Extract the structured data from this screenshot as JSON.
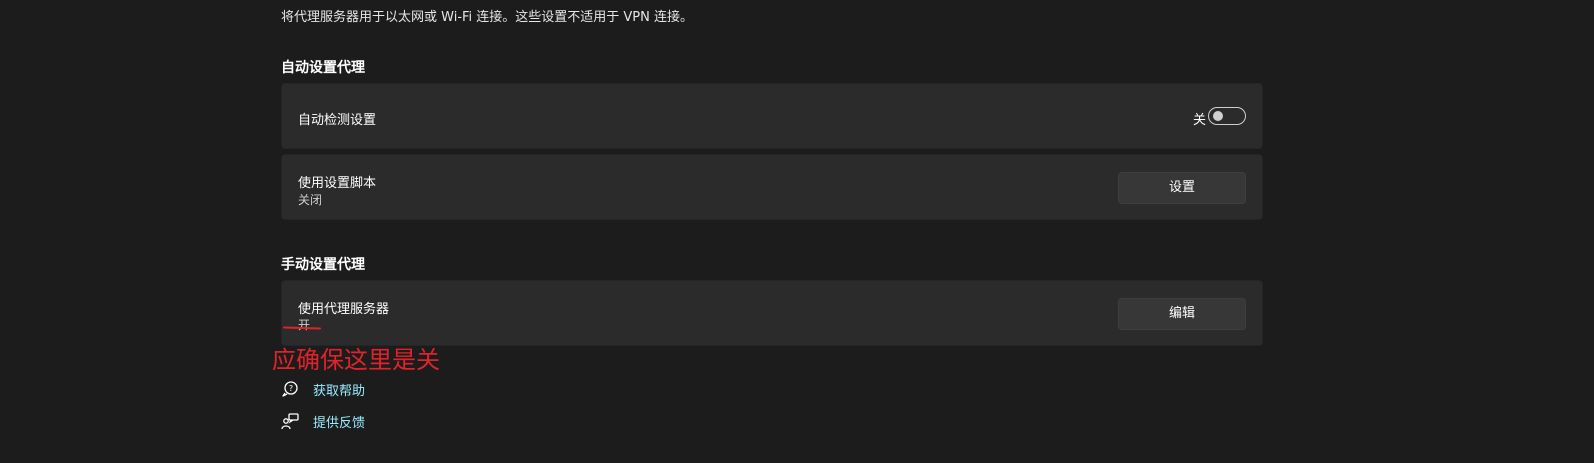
{
  "description": "将代理服务器用于以太网或 Wi-Fi 连接。这些设置不适用于 VPN 连接。",
  "auto_proxy": {
    "section_title": "自动设置代理",
    "auto_detect": {
      "label": "自动检测设置",
      "state_label": "关",
      "enabled": false
    },
    "setup_script": {
      "label": "使用设置脚本",
      "status": "关闭",
      "button_label": "设置"
    }
  },
  "manual_proxy": {
    "section_title": "手动设置代理",
    "use_proxy": {
      "label": "使用代理服务器",
      "status": "开",
      "button_label": "编辑"
    }
  },
  "annotation": {
    "text": "应确保这里是关",
    "color": "#e0232b"
  },
  "links": {
    "help": {
      "label": "获取帮助",
      "icon": "help-icon"
    },
    "feedback": {
      "label": "提供反馈",
      "icon": "feedback-icon"
    }
  },
  "colors": {
    "background": "#1c1c1c",
    "card": "#2b2b2b",
    "link": "#99ebff"
  }
}
